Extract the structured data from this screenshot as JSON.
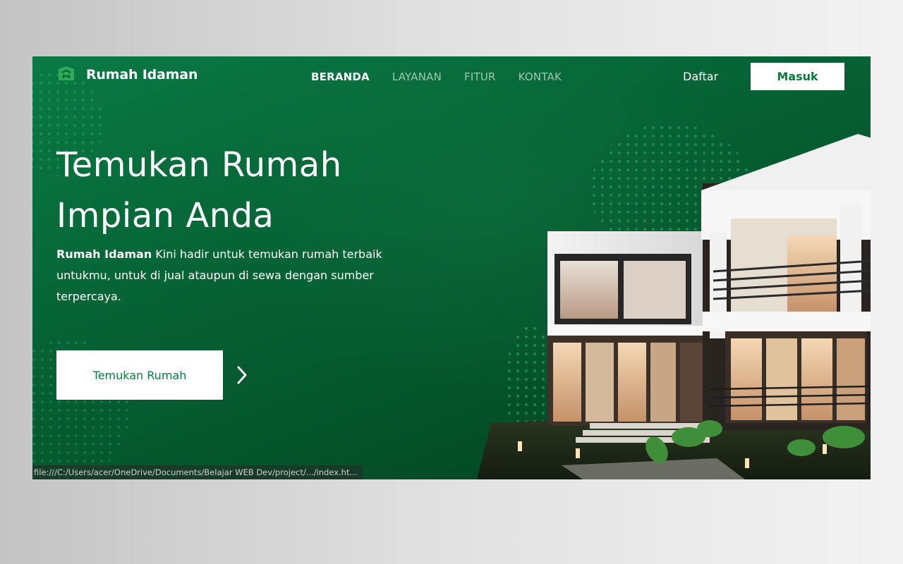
{
  "brand": {
    "name": "Rumah Idaman",
    "icon": "house-logo-icon"
  },
  "nav": {
    "items": [
      {
        "label": "BERANDA",
        "active": true
      },
      {
        "label": "LAYANAN",
        "active": false
      },
      {
        "label": "FITUR",
        "active": false
      },
      {
        "label": "KONTAK",
        "active": false
      }
    ],
    "daftar_label": "Daftar",
    "masuk_label": "Masuk"
  },
  "hero": {
    "title_line1": "Temukan Rumah",
    "title_line2": "Impian Anda",
    "desc_bold": "Rumah Idaman",
    "desc_rest": " Kini hadir untuk temukan rumah terbaik untukmu, untuk di jual ataupun di sewa dengan sumber terpercaya.",
    "cta_label": "Temukan Rumah",
    "cta_arrow_icon": "chevron-right-icon"
  },
  "status_bar": {
    "text": "file:///C:/Users/acer/OneDrive/Documents/Belajar WEB Dev/project/.../index.ht..."
  },
  "colors": {
    "primary_green": "#0b7a3e",
    "nav_inactive": "#9ec9af",
    "white": "#ffffff"
  }
}
